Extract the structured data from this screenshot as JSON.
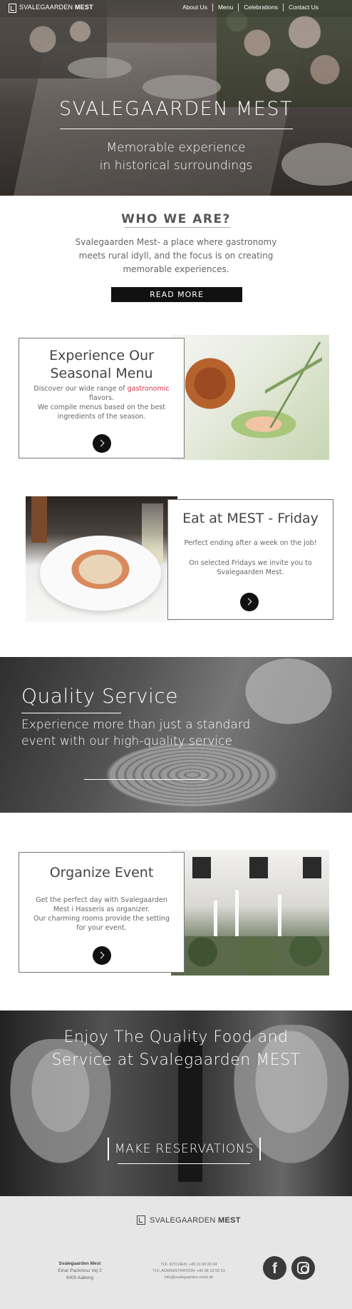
{
  "brand": {
    "name_light": "SVALEGAARDEN",
    "name_bold": "MEST"
  },
  "nav": {
    "links": [
      "About Us",
      "Menu",
      "Celebrations",
      "Contact Us"
    ]
  },
  "hero": {
    "title": "SVALEGAARDEN MEST",
    "subtitle_line1": "Memorable experience",
    "subtitle_line2": "in historical surroundings"
  },
  "who": {
    "title": "WHO WE ARE?",
    "text": "Svalegaarden Mest- a place where gastronomy meets rural idyll, and the focus is on creating memorable experiences.",
    "button": "READ MORE"
  },
  "seasonal": {
    "title": "Experience Our Seasonal Menu",
    "text_before": "Discover our wide range of ",
    "text_accent": "gastronomic",
    "text_after": " flavors.",
    "text2": "We compile menus based on the best ingredients of the season."
  },
  "friday": {
    "title": "Eat at MEST - Friday",
    "text1": "Perfect ending after a week on the job!",
    "text2": "On selected Fridays we invite you to Svalegaarden Mest."
  },
  "quality": {
    "title": "Quality Service",
    "text": "Experience more than just a standard event with our high-quality service"
  },
  "event": {
    "title": "Organize Event",
    "text1": "Get the perfect day with Svalegaarden Mest i Hasseris as organizer.",
    "text2": "Our charming rooms provide the setting for your event."
  },
  "enjoy": {
    "title_line1": "Enjoy The Quality Food and",
    "title_line2": "Service at Svalegaarden MEST",
    "button": "MAKE RESERVATIONS"
  },
  "footer": {
    "company": "Svalegaarden Mest",
    "street": "Einar Packness Vej 2",
    "city": "9000 Aalborg",
    "phone_kitchen": "TLF. KITCHEN: +45 01 00 00 04",
    "phone_admin": "TLF. ADMINISTRATION: +45 98 13 50 53",
    "email": "info@svalegaarden-mest.dk",
    "facebook_glyph": "f"
  },
  "icons": [
    "logo-icon",
    "arrow-right-icon",
    "facebook-icon",
    "instagram-icon"
  ],
  "colors": {
    "accent": "#d7344a",
    "button_dark": "#111111",
    "footer_bg": "#e6e6e6"
  }
}
